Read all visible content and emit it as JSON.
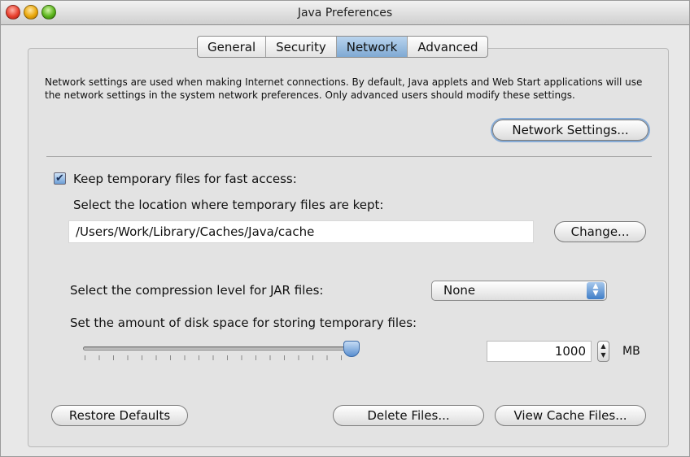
{
  "window": {
    "title": "Java Preferences"
  },
  "tabs": [
    {
      "label": "General",
      "active": false
    },
    {
      "label": "Security",
      "active": false
    },
    {
      "label": "Network",
      "active": true
    },
    {
      "label": "Advanced",
      "active": false
    }
  ],
  "network": {
    "description": "Network settings are used when making Internet connections. By default, Java applets and Web Start applications will use the network settings in the system network preferences. Only advanced users should modify these settings.",
    "settings_button": "Network Settings..."
  },
  "temp_files": {
    "keep_checked": true,
    "keep_label": "Keep temporary files for fast access:",
    "location_label": "Select the location where temporary files are kept:",
    "path": "/Users/Work/Library/Caches/Java/cache",
    "change_button": "Change...",
    "compression_label": "Select the compression level for JAR files:",
    "compression_value": "None",
    "disk_label": "Set the amount of disk space for storing temporary files:",
    "disk_value": "1000",
    "disk_unit": "MB",
    "slider_level": 1.0
  },
  "footer": {
    "restore_button": "Restore Defaults",
    "delete_button": "Delete Files...",
    "view_button": "View Cache Files..."
  },
  "icons": {
    "checkmark": "checkmark-icon",
    "select_arrows": "up-down-arrows-icon",
    "stepper": "stepper-icon"
  },
  "colors": {
    "accent": "#86abd6",
    "active_tab": "#7fa9d3"
  }
}
